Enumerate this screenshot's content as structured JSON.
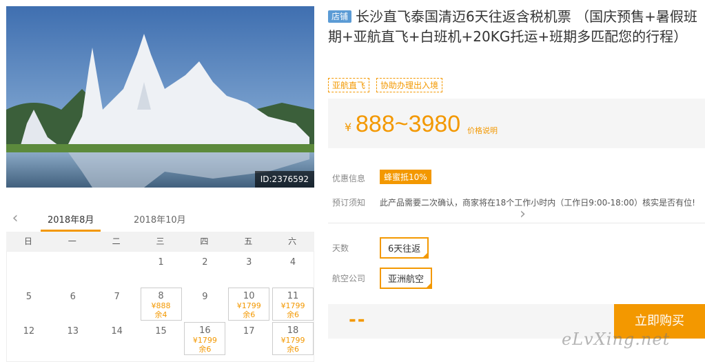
{
  "product": {
    "shop_tag": "店铺",
    "title": "长沙直飞泰国清迈6天往返含税机票 （国庆预售+暑假班期+亚航直飞+白班机+20KG托运+班期多匹配您的行程）",
    "tags": [
      "亚航直飞",
      "协助办理出入境"
    ],
    "image_id": "ID:2376592"
  },
  "price": {
    "symbol": "¥",
    "range": "888~3980",
    "note": "价格说明"
  },
  "info": {
    "promo_label": "优惠信息",
    "promo_badge": "蜂蜜抵10%",
    "notice_label": "预订须知",
    "notice_text": "此产品需要二次确认，商家将在18个工作小时内（工作日9:00-18:00）核实是否有位!"
  },
  "options": {
    "days_label": "天数",
    "days_value": "6天往返",
    "airline_label": "航空公司",
    "airline_value": "亚洲航空"
  },
  "buy": {
    "price_placeholder": "--",
    "button": "立即购买"
  },
  "watermark": "eLvXing.net",
  "calendar": {
    "prev_arrow": "‹",
    "next_arrow": "›",
    "months": [
      "2018年8月",
      "2018年10月"
    ],
    "weekdays": [
      "日",
      "一",
      "二",
      "三",
      "四",
      "五",
      "六"
    ],
    "days": [
      {
        "day": "1",
        "col": 3,
        "row": 0
      },
      {
        "day": "2",
        "col": 4,
        "row": 0
      },
      {
        "day": "3",
        "col": 5,
        "row": 0
      },
      {
        "day": "4",
        "col": 6,
        "row": 0
      },
      {
        "day": "5",
        "col": 0,
        "row": 1
      },
      {
        "day": "6",
        "col": 1,
        "row": 1
      },
      {
        "day": "7",
        "col": 2,
        "row": 1
      },
      {
        "day": "8",
        "col": 3,
        "row": 1,
        "price": "¥888",
        "stock": "余4"
      },
      {
        "day": "9",
        "col": 4,
        "row": 1
      },
      {
        "day": "10",
        "col": 5,
        "row": 1,
        "price": "¥1799",
        "stock": "余6"
      },
      {
        "day": "11",
        "col": 6,
        "row": 1,
        "price": "¥1799",
        "stock": "余6"
      },
      {
        "day": "12",
        "col": 0,
        "row": 2
      },
      {
        "day": "13",
        "col": 1,
        "row": 2
      },
      {
        "day": "14",
        "col": 2,
        "row": 2
      },
      {
        "day": "15",
        "col": 3,
        "row": 2
      },
      {
        "day": "16",
        "col": 4,
        "row": 2,
        "price": "¥1799",
        "stock": "余6"
      },
      {
        "day": "17",
        "col": 5,
        "row": 2
      },
      {
        "day": "18",
        "col": 6,
        "row": 2,
        "price": "¥1799",
        "stock": "余6"
      }
    ]
  }
}
